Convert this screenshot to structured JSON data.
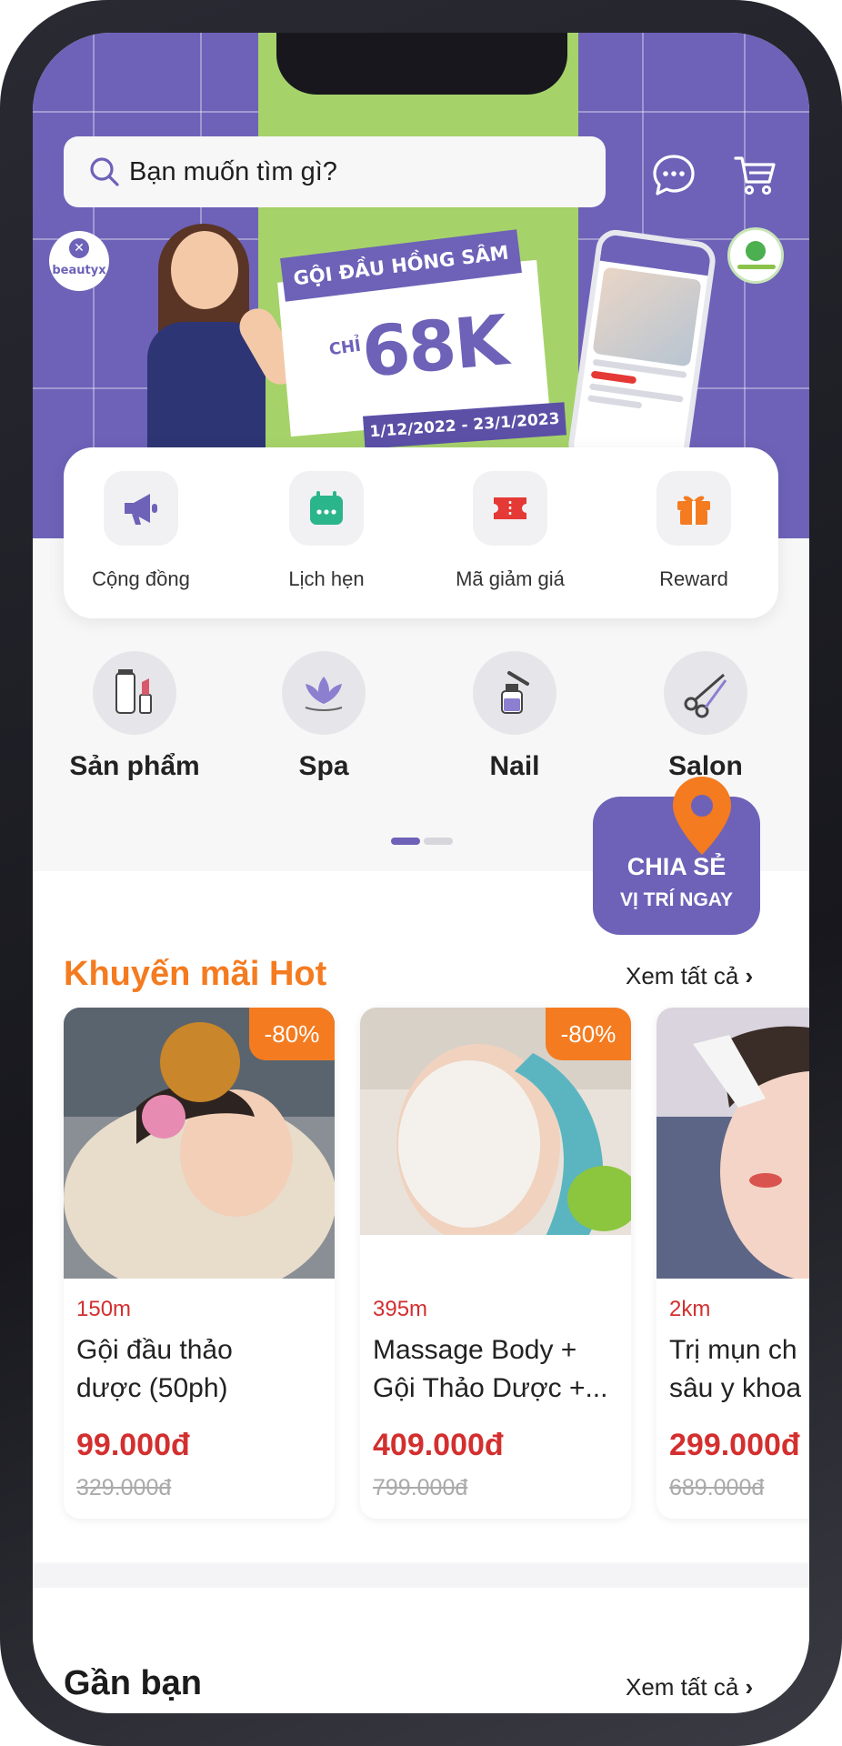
{
  "search": {
    "placeholder": "Bạn muốn tìm gì?"
  },
  "header_icons": {
    "chat": "chat-bubble-icon",
    "cart": "cart-icon"
  },
  "banner": {
    "brand": "beautyx",
    "promo_title": "GỘI ĐẦU HỒNG SÂM",
    "promo_chi": "CHỈ",
    "promo_price": "68K",
    "promo_date": "1/12/2022 - 23/1/2023"
  },
  "quick_actions": [
    {
      "label": "Cộng đồng",
      "icon": "megaphone-icon",
      "color": "#6d62b8"
    },
    {
      "label": "Lịch hẹn",
      "icon": "calendar-icon",
      "color": "#2bb58a"
    },
    {
      "label": "Mã giảm giá",
      "icon": "ticket-icon",
      "color": "#e53935"
    },
    {
      "label": "Reward",
      "icon": "gift-icon",
      "color": "#f47b20"
    }
  ],
  "categories": [
    {
      "label": "Sản phẩm",
      "icon": "cosmetics-icon"
    },
    {
      "label": "Spa",
      "icon": "lotus-icon"
    },
    {
      "label": "Nail",
      "icon": "nail-polish-icon"
    },
    {
      "label": "Salon",
      "icon": "scissors-icon"
    }
  ],
  "share_location": {
    "line1": "CHIA SẺ",
    "line2": "VỊ TRÍ NGAY"
  },
  "hot_section": {
    "title": "Khuyến mãi Hot",
    "see_all": "Xem tất cả"
  },
  "deals": [
    {
      "discount": "-80%",
      "distance": "150m",
      "name_line1": "Gội đầu thảo",
      "name_line2": "dược (50ph)",
      "price": "99.000đ",
      "old_price": "329.000đ"
    },
    {
      "discount": "-80%",
      "distance": "395m",
      "name_line1": "Massage Body +",
      "name_line2": "Gội Thảo Dược +...",
      "price": "409.000đ",
      "old_price": "799.000đ"
    },
    {
      "discount": "",
      "distance": "2km",
      "name_line1": "Trị mụn ch",
      "name_line2": "sâu y khoa",
      "price": "299.000đ",
      "old_price": "689.000đ"
    }
  ],
  "near_section": {
    "title": "Gần bạn",
    "see_all": "Xem tất cả"
  },
  "colors": {
    "brand_purple": "#6d62b8",
    "accent_orange": "#f47b20",
    "price_red": "#d32f2f",
    "banner_green": "#a6d26a"
  }
}
